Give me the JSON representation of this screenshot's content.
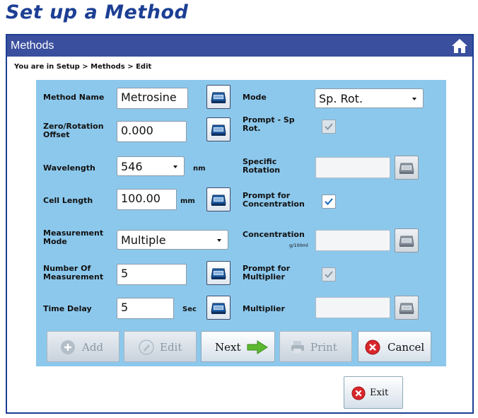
{
  "page_heading": "Set up a Method",
  "window": {
    "title": "Methods",
    "home_icon": "home-icon",
    "breadcrumb": "You are in  Setup > Methods > Edit"
  },
  "form": {
    "method_name": {
      "label": "Method Name",
      "value": "Metrosine"
    },
    "zero_offset": {
      "label": "Zero/Rotation Offset",
      "value": "0.000"
    },
    "wavelength": {
      "label": "Wavelength",
      "value": "546",
      "unit": "nm"
    },
    "cell_length": {
      "label": "Cell Length",
      "value": "100.00",
      "unit": "mm"
    },
    "measurement_mode": {
      "label": "Measurement Mode",
      "value": "Multiple"
    },
    "number_of_measurement": {
      "label": "Number Of Measurement",
      "value": "5"
    },
    "time_delay": {
      "label": "Time Delay",
      "value": "5",
      "unit": "Sec"
    },
    "mode": {
      "label": "Mode",
      "value": "Sp. Rot."
    },
    "prompt_sp_rot": {
      "label": "Prompt - Sp Rot.",
      "checked": true,
      "enabled": false
    },
    "specific_rotation": {
      "label": "Specific Rotation",
      "value": ""
    },
    "prompt_concentration": {
      "label": "Prompt for Concentration",
      "checked": true,
      "enabled": true
    },
    "concentration": {
      "label": "Concentration",
      "unit": "g/100ml",
      "value": ""
    },
    "prompt_multiplier": {
      "label": "Prompt for Multiplier",
      "checked": true,
      "enabled": false
    },
    "multiplier": {
      "label": "Multiplier",
      "value": ""
    },
    "keyboard_icon": "keyboard-icon"
  },
  "buttons": {
    "add": "Add",
    "edit": "Edit",
    "next": "Next",
    "print": "Print",
    "cancel": "Cancel",
    "exit": "Exit"
  },
  "colors": {
    "heading": "#1c3f94",
    "titlebar": "#3a4f9e",
    "panel": "#8cc8ec",
    "check": "#1565c0",
    "cancel_red": "#d8262b",
    "next_green": "#5bb830"
  }
}
